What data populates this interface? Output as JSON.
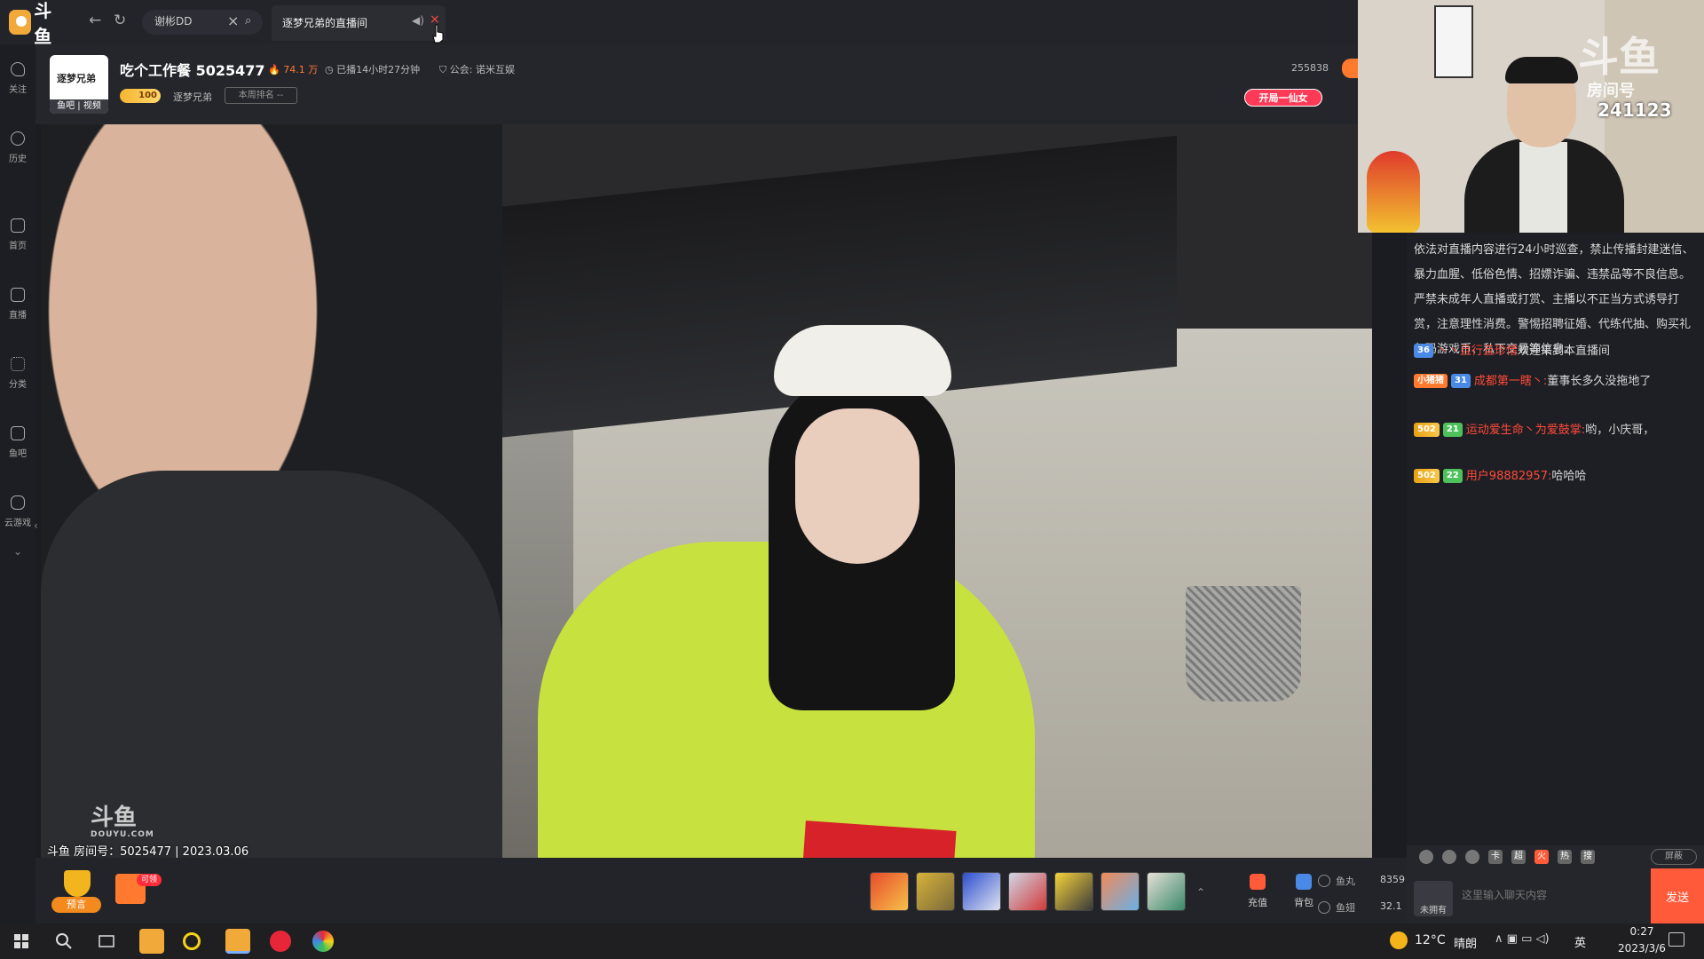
{
  "topbar": {
    "logo_text": "斗鱼",
    "search_value": "谢彬DD",
    "active_tab_title": "逐梦兄弟的直播间"
  },
  "sidebar": {
    "items": [
      {
        "label": "关注",
        "icon": "heart-icon"
      },
      {
        "label": "历史",
        "icon": "clock-icon"
      },
      {
        "label": "首页",
        "icon": "home-icon"
      },
      {
        "label": "直播",
        "icon": "live-icon"
      },
      {
        "label": "分类",
        "icon": "grid-icon"
      },
      {
        "label": "鱼吧",
        "icon": "fishbar-icon"
      },
      {
        "label": "云游戏",
        "icon": "gamepad-icon"
      }
    ]
  },
  "room": {
    "avatar_text": "逐梦兄弟",
    "avatar_bar": "鱼吧 | 视频",
    "title": "吃个工作餐 5025477",
    "hot": "74.1 万",
    "live_time": "已播14小时27分钟",
    "guild": "公会: 诺米互娱",
    "fans_level": "100",
    "anchor_name": "逐梦兄弟",
    "rank_label": "本周排名 --",
    "viewer_count": "255838",
    "kaiju_label": "开局一仙女"
  },
  "video": {
    "watermark_logo": "斗鱼",
    "watermark_sub": "DOUYU.COM",
    "caption": "斗鱼 房间号：5025477 | 2023.03.06"
  },
  "cam_overlay": {
    "logo": "斗鱼",
    "room_label": "房间号",
    "room_number": "241123"
  },
  "chat": {
    "notice": "依法对直播内容进行24小时巡查，禁止传播封建迷信、暴力血腥、低俗色情、招嫖诈骗、违禁品等不良信息。严禁未成年人直播或打赏、主播以不正当方式诱导打赏，注意理性消费。警惕招聘征婚、代练代抽、购买礼包码游戏币、私下交易等信息。",
    "messages": [
      {
        "badges": [
          {
            "text": "36",
            "style": "blue"
          }
        ],
        "user": "丶丶且行且珍惜",
        "text": "欢迎来到本直播间",
        "user_style": "red"
      },
      {
        "badges": [
          {
            "text": "小猪猪",
            "style": "orange"
          },
          {
            "text": "31",
            "style": "blue"
          }
        ],
        "user": "成都第一瞎丶:",
        "text": "董事长多久没拖地了",
        "user_style": "red"
      },
      {
        "badges": [
          {
            "text": "502",
            "style": "gold"
          },
          {
            "text": "21",
            "style": "green"
          }
        ],
        "user": "运动爱生命丶为爱鼓掌:",
        "text": "哟，小庆哥，",
        "user_style": "red"
      },
      {
        "badges": [
          {
            "text": "502",
            "style": "gold"
          },
          {
            "text": "22",
            "style": "green"
          }
        ],
        "user": "用户98882957:",
        "text": "哈哈哈",
        "user_style": "red"
      }
    ],
    "tools": [
      {
        "icon": "emoji-icon",
        "text": ""
      },
      {
        "icon": "horn-icon",
        "text": ""
      },
      {
        "icon": "star-icon",
        "text": ""
      },
      {
        "icon": "card-icon",
        "text": "卡"
      },
      {
        "icon": "super-icon",
        "text": "超"
      },
      {
        "icon": "hot-icon",
        "text": "火"
      },
      {
        "icon": "heat-icon",
        "text": "热"
      },
      {
        "icon": "search-barrage-icon",
        "text": "搜"
      }
    ],
    "block_label": "屏蔽",
    "not_own_label": "未拥有",
    "input_placeholder": "这里输入聊天内容",
    "send_label": "发送"
  },
  "giftbar": {
    "prophecy_label": "预言",
    "gift_badge": "可领",
    "recharge_label": "充值",
    "backpack_label": "背包",
    "fishball_label": "鱼丸",
    "fishball_value": "8359",
    "fishwing_label": "鱼翅",
    "fishwing_value": "32.1"
  },
  "taskbar": {
    "temperature": "12°C",
    "weather": "晴朗",
    "ime": "英",
    "time": "0:27",
    "date": "2023/3/6"
  },
  "colors": {
    "accent": "#ff5a3a",
    "hot": "#ff7a2f",
    "panel": "#1e1f24",
    "badge_blue": "#4a8ae6",
    "badge_green": "#4ec05c",
    "badge_gold": "#f5b531"
  }
}
